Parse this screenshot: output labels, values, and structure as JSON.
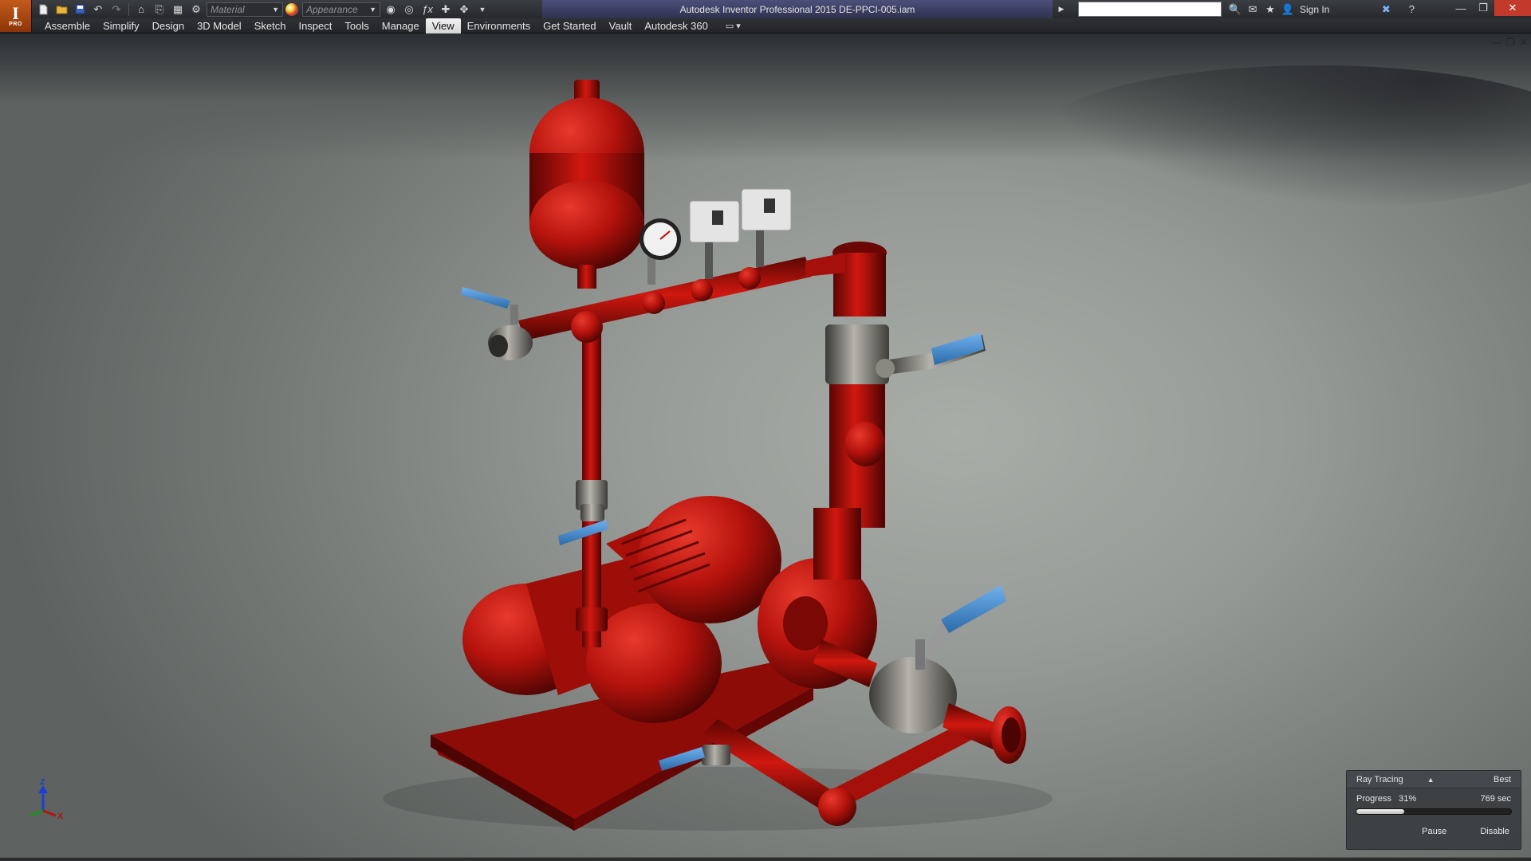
{
  "app": {
    "logo_letter": "I",
    "logo_badge": "PRO",
    "window_title": "Autodesk Inventor Professional 2015    DE-PPCI-005.iam"
  },
  "quick_access": {
    "material_placeholder": "Material",
    "appearance_placeholder": "Appearance",
    "icons": [
      "new-icon",
      "open-icon",
      "save-icon",
      "undo-icon",
      "redo-icon",
      "home-icon",
      "return-icon",
      "select-icon",
      "update-icon",
      "zoom-icon",
      "measure-icon",
      "function-icon",
      "move-icon",
      "orbit-icon"
    ]
  },
  "header_right": {
    "sign_in": "Sign In",
    "icons": [
      "search-tools-icon",
      "communication-icon",
      "favorites-icon",
      "user-icon",
      "exchange-icon",
      "help-icon"
    ]
  },
  "ribbon": {
    "tabs": [
      {
        "label": "Assemble"
      },
      {
        "label": "Simplify"
      },
      {
        "label": "Design"
      },
      {
        "label": "3D Model"
      },
      {
        "label": "Sketch"
      },
      {
        "label": "Inspect"
      },
      {
        "label": "Tools"
      },
      {
        "label": "Manage"
      },
      {
        "label": "View",
        "active": true
      },
      {
        "label": "Environments"
      },
      {
        "label": "Get Started"
      },
      {
        "label": "Vault"
      },
      {
        "label": "Autodesk 360"
      }
    ]
  },
  "viewcube": {
    "z": "Z",
    "x": "X"
  },
  "ray_tracing": {
    "title": "Ray Tracing",
    "quality": "Best",
    "progress_label": "Progress",
    "progress_value": "31%",
    "progress_fraction": 0.31,
    "time": "769 sec",
    "pause": "Pause",
    "disable": "Disable"
  },
  "colors": {
    "pipe_red": "#b3120c",
    "handle_blue": "#3f86c9",
    "brass_gray": "#8a8880",
    "accent_orange": "#c35a1b"
  }
}
